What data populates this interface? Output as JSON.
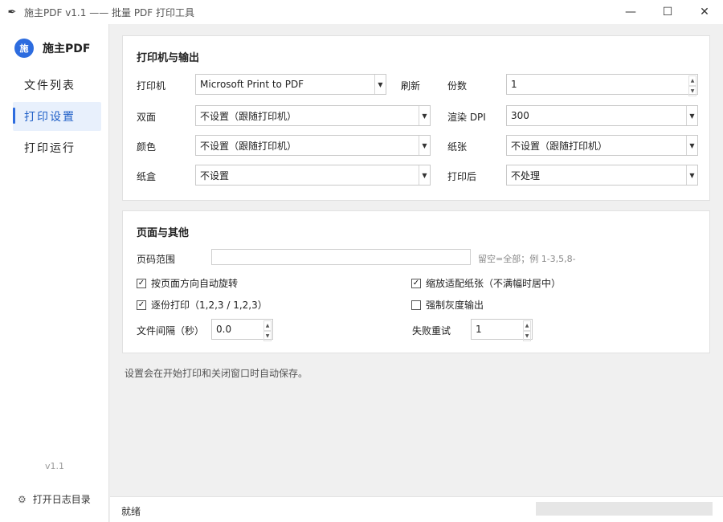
{
  "window": {
    "title": "施主PDF v1.1 —— 批量 PDF 打印工具",
    "app_icon": "feather-icon",
    "minimize": "—",
    "maximize": "☐",
    "close": "✕"
  },
  "sidebar": {
    "logo_text": "施",
    "brand": "施主PDF",
    "items": [
      {
        "label": "文件列表",
        "active": false
      },
      {
        "label": "打印设置",
        "active": true
      },
      {
        "label": "打印运行",
        "active": false
      }
    ],
    "version": "v1.1",
    "log_label": "打开日志目录",
    "log_icon": "gear-icon"
  },
  "printer_section": {
    "title": "打印机与输出",
    "printer_label": "打印机",
    "printer_value": "Microsoft Print to PDF",
    "refresh_label": "刷新",
    "copies_label": "份数",
    "copies_value": "1",
    "duplex_label": "双面",
    "duplex_value": "不设置（跟随打印机）",
    "dpi_label": "渲染 DPI",
    "dpi_value": "300",
    "color_label": "颜色",
    "color_value": "不设置（跟随打印机）",
    "paper_label": "纸张",
    "paper_value": "不设置（跟随打印机）",
    "tray_label": "纸盒",
    "tray_value": "不设置",
    "after_label": "打印后",
    "after_value": "不处理"
  },
  "page_section": {
    "title": "页面与其他",
    "range_label": "页码范围",
    "range_value": "",
    "range_hint": "留空=全部；例 1-3,5,8-",
    "auto_rotate_label": "按页面方向自动旋转",
    "auto_rotate_checked": true,
    "fit_paper_label": "缩放适配纸张（不满幅时居中）",
    "fit_paper_checked": true,
    "collate_label": "逐份打印（1,2,3 / 1,2,3）",
    "collate_checked": true,
    "grayscale_label": "强制灰度输出",
    "grayscale_checked": false,
    "interval_label": "文件间隔（秒）",
    "interval_value": "0.0",
    "retry_label": "失败重试",
    "retry_value": "1"
  },
  "note": "设置会在开始打印和关闭窗口时自动保存。",
  "statusbar": {
    "status": "就绪",
    "progress": 0
  },
  "colors": {
    "accent": "#2d6cdf",
    "nav_active_bg": "#e8f0fc"
  }
}
